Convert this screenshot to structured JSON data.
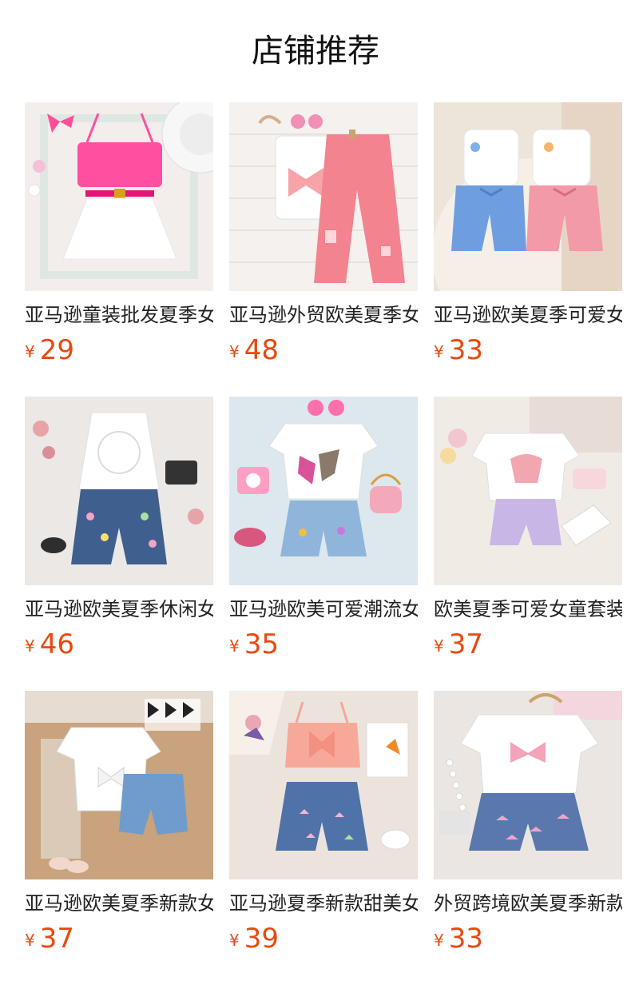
{
  "page_title": "店铺推荐",
  "currency": "¥",
  "products": [
    {
      "name": "亚马逊童装批发夏季女童套装",
      "price": "29",
      "image": "pink-bow-top-white-skirt"
    },
    {
      "name": "亚马逊外贸欧美夏季女童套装",
      "price": "48",
      "image": "white-vest-pink-jeans"
    },
    {
      "name": "亚马逊欧美夏季可爱女童套装",
      "price": "33",
      "image": "ruffle-tops-blue-pink-shorts"
    },
    {
      "name": "亚马逊欧美夏季休闲女童套装",
      "price": "46",
      "image": "white-flower-cami-denim-shorts"
    },
    {
      "name": "亚马逊欧美可爱潮流女童套装",
      "price": "35",
      "image": "butterfly-tee-denim-shorts"
    },
    {
      "name": "欧美夏季可爱女童套装批发",
      "price": "37",
      "image": "strawberry-tee-lilac-shorts"
    },
    {
      "name": "亚马逊欧美夏季新款女童套装",
      "price": "37",
      "image": "bow-tee-denim-shorts"
    },
    {
      "name": "亚马逊夏季新款甜美女童套装",
      "price": "39",
      "image": "pink-bow-cami-butterfly-shorts"
    },
    {
      "name": "外贸跨境欧美夏季新款女童套装",
      "price": "33",
      "image": "bow-print-tee-denim-shorts"
    }
  ]
}
